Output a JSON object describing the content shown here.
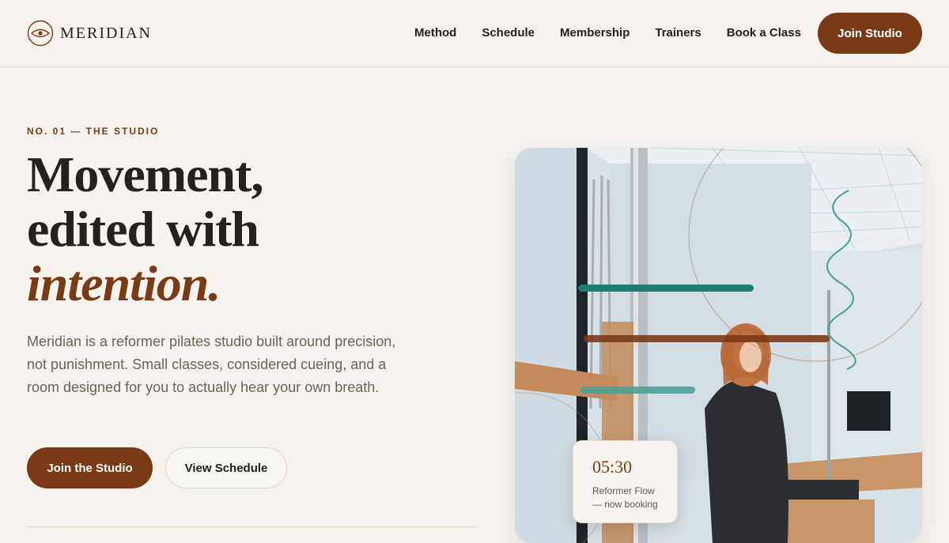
{
  "brand": {
    "name": "MERIDIAN",
    "logo_icon": "eye-icon"
  },
  "nav": {
    "items": [
      {
        "label": "Method"
      },
      {
        "label": "Schedule"
      },
      {
        "label": "Membership"
      },
      {
        "label": "Trainers"
      },
      {
        "label": "Book a Class"
      }
    ],
    "cta_label": "Join Studio"
  },
  "hero": {
    "eyebrow": "NO. 01 — THE STUDIO",
    "headline": {
      "line1": "Movement,",
      "line2": "edited with",
      "accent": "intention."
    },
    "lede": "Meridian is a reformer pilates studio built around precision, not punishment. Small classes, considered cueing, and a room designed for you to actually hear your own breath.",
    "primary_cta": "Join the Studio",
    "secondary_cta": "View Schedule"
  },
  "class_card": {
    "time": "05:30",
    "line1": "Reformer Flow",
    "line2": "— now booking"
  },
  "colors": {
    "accent": "#7a3a16",
    "background": "#f6f3ef",
    "text": "#25211d",
    "teal": "#1f7a72"
  }
}
